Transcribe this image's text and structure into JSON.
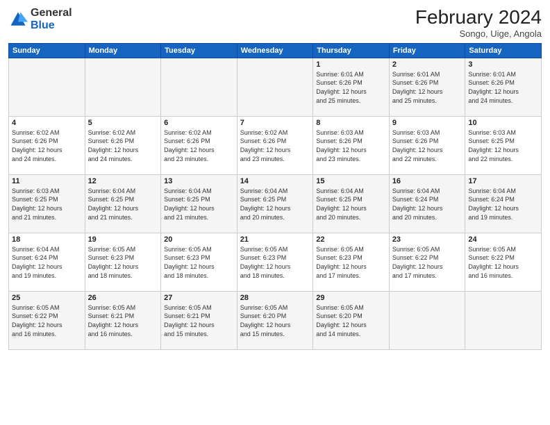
{
  "logo": {
    "general": "General",
    "blue": "Blue"
  },
  "title": {
    "month_year": "February 2024",
    "location": "Songo, Uige, Angola"
  },
  "days_of_week": [
    "Sunday",
    "Monday",
    "Tuesday",
    "Wednesday",
    "Thursday",
    "Friday",
    "Saturday"
  ],
  "weeks": [
    [
      {
        "day": "",
        "info": ""
      },
      {
        "day": "",
        "info": ""
      },
      {
        "day": "",
        "info": ""
      },
      {
        "day": "",
        "info": ""
      },
      {
        "day": "1",
        "info": "Sunrise: 6:01 AM\nSunset: 6:26 PM\nDaylight: 12 hours\nand 25 minutes."
      },
      {
        "day": "2",
        "info": "Sunrise: 6:01 AM\nSunset: 6:26 PM\nDaylight: 12 hours\nand 25 minutes."
      },
      {
        "day": "3",
        "info": "Sunrise: 6:01 AM\nSunset: 6:26 PM\nDaylight: 12 hours\nand 24 minutes."
      }
    ],
    [
      {
        "day": "4",
        "info": "Sunrise: 6:02 AM\nSunset: 6:26 PM\nDaylight: 12 hours\nand 24 minutes."
      },
      {
        "day": "5",
        "info": "Sunrise: 6:02 AM\nSunset: 6:26 PM\nDaylight: 12 hours\nand 24 minutes."
      },
      {
        "day": "6",
        "info": "Sunrise: 6:02 AM\nSunset: 6:26 PM\nDaylight: 12 hours\nand 23 minutes."
      },
      {
        "day": "7",
        "info": "Sunrise: 6:02 AM\nSunset: 6:26 PM\nDaylight: 12 hours\nand 23 minutes."
      },
      {
        "day": "8",
        "info": "Sunrise: 6:03 AM\nSunset: 6:26 PM\nDaylight: 12 hours\nand 23 minutes."
      },
      {
        "day": "9",
        "info": "Sunrise: 6:03 AM\nSunset: 6:26 PM\nDaylight: 12 hours\nand 22 minutes."
      },
      {
        "day": "10",
        "info": "Sunrise: 6:03 AM\nSunset: 6:25 PM\nDaylight: 12 hours\nand 22 minutes."
      }
    ],
    [
      {
        "day": "11",
        "info": "Sunrise: 6:03 AM\nSunset: 6:25 PM\nDaylight: 12 hours\nand 21 minutes."
      },
      {
        "day": "12",
        "info": "Sunrise: 6:04 AM\nSunset: 6:25 PM\nDaylight: 12 hours\nand 21 minutes."
      },
      {
        "day": "13",
        "info": "Sunrise: 6:04 AM\nSunset: 6:25 PM\nDaylight: 12 hours\nand 21 minutes."
      },
      {
        "day": "14",
        "info": "Sunrise: 6:04 AM\nSunset: 6:25 PM\nDaylight: 12 hours\nand 20 minutes."
      },
      {
        "day": "15",
        "info": "Sunrise: 6:04 AM\nSunset: 6:25 PM\nDaylight: 12 hours\nand 20 minutes."
      },
      {
        "day": "16",
        "info": "Sunrise: 6:04 AM\nSunset: 6:24 PM\nDaylight: 12 hours\nand 20 minutes."
      },
      {
        "day": "17",
        "info": "Sunrise: 6:04 AM\nSunset: 6:24 PM\nDaylight: 12 hours\nand 19 minutes."
      }
    ],
    [
      {
        "day": "18",
        "info": "Sunrise: 6:04 AM\nSunset: 6:24 PM\nDaylight: 12 hours\nand 19 minutes."
      },
      {
        "day": "19",
        "info": "Sunrise: 6:05 AM\nSunset: 6:23 PM\nDaylight: 12 hours\nand 18 minutes."
      },
      {
        "day": "20",
        "info": "Sunrise: 6:05 AM\nSunset: 6:23 PM\nDaylight: 12 hours\nand 18 minutes."
      },
      {
        "day": "21",
        "info": "Sunrise: 6:05 AM\nSunset: 6:23 PM\nDaylight: 12 hours\nand 18 minutes."
      },
      {
        "day": "22",
        "info": "Sunrise: 6:05 AM\nSunset: 6:23 PM\nDaylight: 12 hours\nand 17 minutes."
      },
      {
        "day": "23",
        "info": "Sunrise: 6:05 AM\nSunset: 6:22 PM\nDaylight: 12 hours\nand 17 minutes."
      },
      {
        "day": "24",
        "info": "Sunrise: 6:05 AM\nSunset: 6:22 PM\nDaylight: 12 hours\nand 16 minutes."
      }
    ],
    [
      {
        "day": "25",
        "info": "Sunrise: 6:05 AM\nSunset: 6:22 PM\nDaylight: 12 hours\nand 16 minutes."
      },
      {
        "day": "26",
        "info": "Sunrise: 6:05 AM\nSunset: 6:21 PM\nDaylight: 12 hours\nand 16 minutes."
      },
      {
        "day": "27",
        "info": "Sunrise: 6:05 AM\nSunset: 6:21 PM\nDaylight: 12 hours\nand 15 minutes."
      },
      {
        "day": "28",
        "info": "Sunrise: 6:05 AM\nSunset: 6:20 PM\nDaylight: 12 hours\nand 15 minutes."
      },
      {
        "day": "29",
        "info": "Sunrise: 6:05 AM\nSunset: 6:20 PM\nDaylight: 12 hours\nand 14 minutes."
      },
      {
        "day": "",
        "info": ""
      },
      {
        "day": "",
        "info": ""
      }
    ]
  ]
}
